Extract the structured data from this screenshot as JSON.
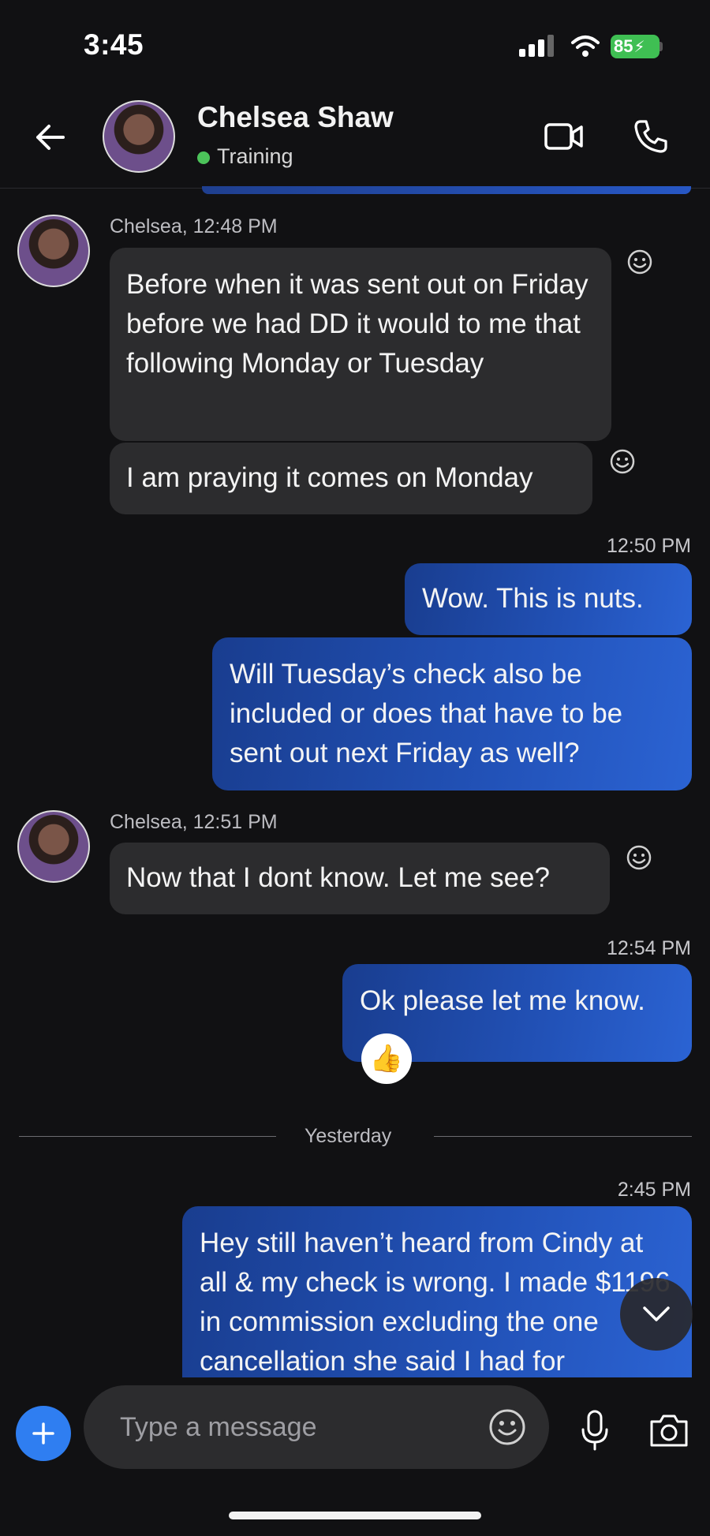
{
  "status_bar": {
    "time": "3:45",
    "battery": "85"
  },
  "header": {
    "contact_name": "Chelsea Shaw",
    "presence": "Training"
  },
  "messages": [
    {
      "sender_line": "Chelsea, 12:48 PM",
      "bubbles": [
        "Before when it was sent out on Friday before we had DD it would to me that following Monday or Tuesday",
        "I am praying it comes on Monday"
      ]
    },
    {
      "time": "12:50 PM",
      "bubbles": [
        "Wow. This is nuts.",
        "Will Tuesday’s check also be included or does that have to be sent out next Friday as well?"
      ]
    },
    {
      "sender_line": "Chelsea, 12:51 PM",
      "bubbles": [
        "Now that I dont know. Let me see?"
      ]
    },
    {
      "time": "12:54 PM",
      "bubbles": [
        "Ok please let me know."
      ],
      "reaction": "👍"
    },
    {
      "time": "2:45 PM",
      "bubbles": [
        "Hey still haven’t heard from Cindy at all & my check is wrong. I made $1196 in commission excluding the one cancellation she said I had for"
      ]
    }
  ],
  "divider": {
    "label": "Yesterday"
  },
  "composer": {
    "placeholder": "Type a message"
  }
}
